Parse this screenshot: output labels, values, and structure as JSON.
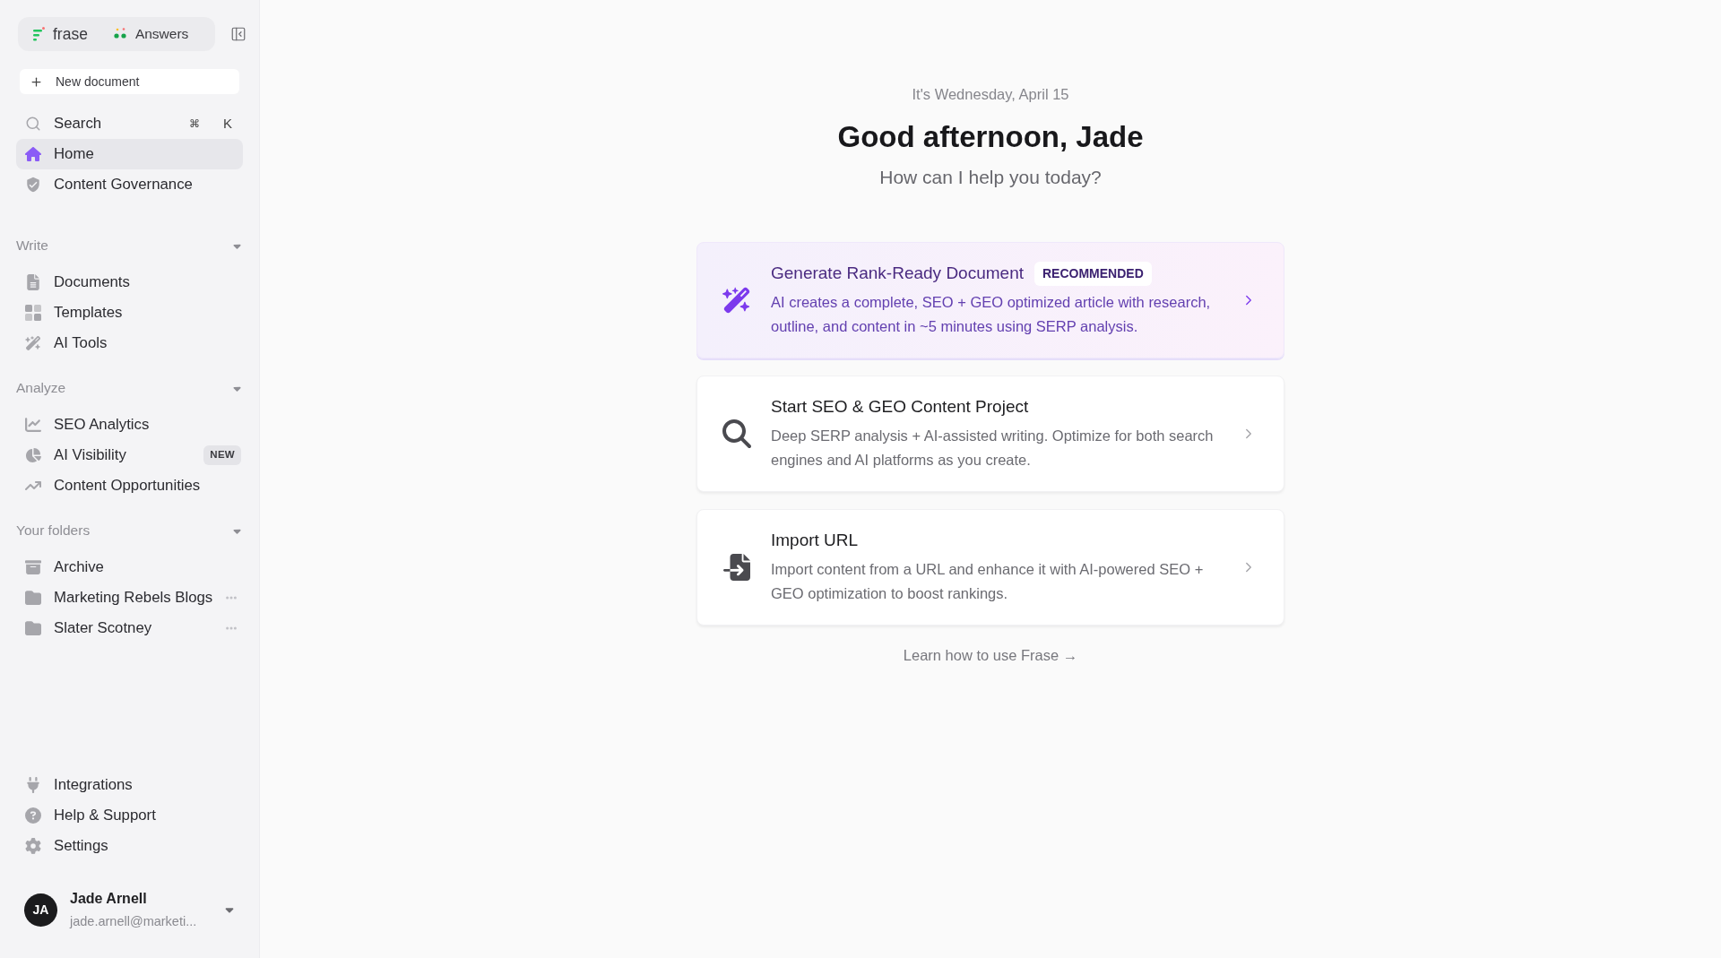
{
  "sidebar": {
    "product_tabs": [
      {
        "label": "frase"
      },
      {
        "label": "Answers"
      }
    ],
    "new_document": "New document",
    "quick_nav": [
      {
        "label": "Search",
        "kind": "search",
        "shortcut": [
          "⌘",
          "K"
        ],
        "selected": false
      },
      {
        "label": "Home",
        "kind": "link",
        "selected": true
      },
      {
        "label": "Content Governance",
        "kind": "link",
        "selected": false
      }
    ],
    "sections": [
      {
        "title": "Write",
        "expanded": true,
        "items": [
          {
            "label": "Documents",
            "kind": "link",
            "selected": false
          },
          {
            "label": "Templates",
            "kind": "link",
            "selected": false
          },
          {
            "label": "AI Tools",
            "kind": "link",
            "selected": false
          }
        ]
      },
      {
        "title": "Analyze",
        "expanded": true,
        "items": [
          {
            "label": "SEO Analytics",
            "kind": "link",
            "selected": false
          },
          {
            "label": "AI Visibility",
            "kind": "link",
            "badge": "NEW",
            "selected": false
          },
          {
            "label": "Content Opportunities",
            "kind": "link",
            "selected": false
          }
        ]
      },
      {
        "title": "Your folders",
        "expanded": true,
        "items": [
          {
            "label": "Archive",
            "kind": "archive",
            "selected": false
          },
          {
            "label": "Marketing Rebels Blogs",
            "kind": "folder",
            "selected": false
          },
          {
            "label": "Slater Scotney",
            "kind": "folder",
            "selected": false
          }
        ]
      }
    ],
    "footer_items": [
      {
        "label": "Integrations",
        "selected": false
      },
      {
        "label": "Help & Support",
        "selected": false
      },
      {
        "label": "Settings",
        "selected": false
      }
    ],
    "user": {
      "initials": "JA",
      "name": "Jade Arnell",
      "email": "jade.arnell@marketi..."
    }
  },
  "main": {
    "date": "It's Wednesday, April 15",
    "greeting": "Good afternoon, Jade",
    "prompt": "How can I help you today?",
    "cards": [
      {
        "kind": "featured",
        "title": "Generate Rank-Ready Document",
        "badge": "RECOMMENDED",
        "description": "AI creates a complete, SEO + GEO optimized article with research, outline, and content in ~5 minutes using SERP analysis."
      },
      {
        "kind": "standard",
        "title": "Start SEO & GEO Content Project",
        "description": "Deep SERP analysis + AI-assisted writing. Optimize for both search engines and AI platforms as you create."
      },
      {
        "kind": "standard",
        "title": "Import URL",
        "description": "Import content from a URL and enhance it with AI-powered SEO + GEO optimization to boost rankings."
      }
    ],
    "learn_link": "Learn how to use Frase →"
  }
}
